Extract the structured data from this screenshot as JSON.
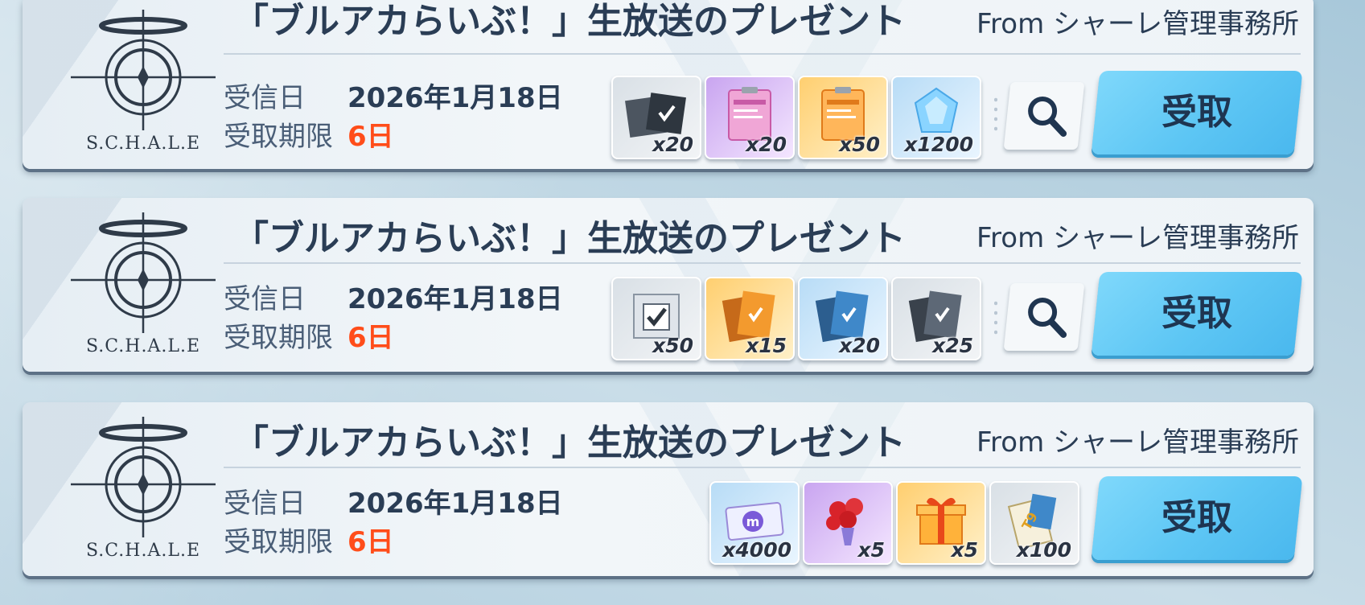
{
  "logo_text": "S.C.H.A.L.E",
  "labels": {
    "received": "受信日",
    "deadline": "受取期限"
  },
  "colors": {
    "claim": "#5dc6f4",
    "deadline": "#ff4d1a",
    "text": "#2a3d55"
  },
  "mails": [
    {
      "title": "「ブルアカらいぶ！」生放送のプレゼント",
      "from": "From シャーレ管理事務所",
      "date": "2026年1月18日",
      "deadline": "6日",
      "claim_label": "受取",
      "items": [
        {
          "icon": "ex-skill-ticket-box-icon",
          "qty": "x20"
        },
        {
          "icon": "report-purple-icon",
          "qty": "x20"
        },
        {
          "icon": "report-orange-icon",
          "qty": "x50"
        },
        {
          "icon": "blue-crystal-icon",
          "qty": "x1200"
        }
      ]
    },
    {
      "title": "「ブルアカらいぶ！」生放送のプレゼント",
      "from": "From シャーレ管理事務所",
      "date": "2026年1月18日",
      "deadline": "6日",
      "claim_label": "受取",
      "items": [
        {
          "icon": "selection-box-icon",
          "qty": "x50"
        },
        {
          "icon": "gold-select-ticket-icon",
          "qty": "x15"
        },
        {
          "icon": "blue-select-ticket-icon",
          "qty": "x20"
        },
        {
          "icon": "gray-select-ticket-icon",
          "qty": "x25"
        }
      ]
    },
    {
      "title": "「ブルアカらいぶ！」生放送のプレゼント",
      "from": "From シャーレ管理事務所",
      "date": "2026年1月18日",
      "deadline": "6日",
      "claim_label": "受取",
      "items": [
        {
          "icon": "momo-ticket-icon",
          "qty": "x4000"
        },
        {
          "icon": "rose-bouquet-icon",
          "qty": "x5"
        },
        {
          "icon": "gift-box-icon",
          "qty": "x5"
        },
        {
          "icon": "t9-equipment-ticket-icon",
          "qty": "x100"
        }
      ]
    }
  ]
}
